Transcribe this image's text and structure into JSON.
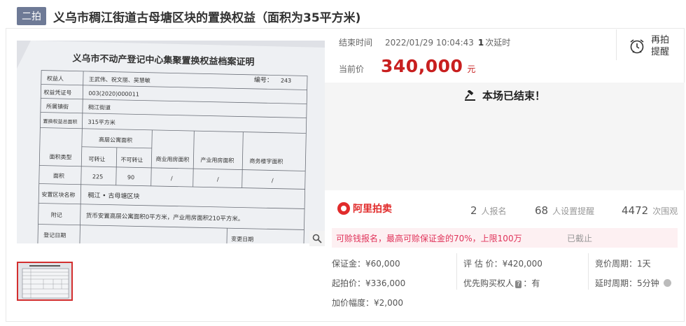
{
  "header": {
    "tag": "二拍",
    "title": "义乌市稠江街道古母塘区块的置换权益（面积为35平方米)"
  },
  "photo": {
    "doc_title": "义乌市不动产登记中心集聚置换权益档案证明",
    "doc_no_label": "编号：",
    "doc_no": "243",
    "rows": [
      {
        "k": "权益人",
        "v": "王武伟、祝文丽、吴慧敏"
      },
      {
        "k": "权益凭证号",
        "v": "003(2020)000011"
      },
      {
        "k": "所属镇街",
        "v": "稠江街道"
      },
      {
        "k": "置换权益总面积",
        "v": "315平方米"
      }
    ],
    "area_type_label": "面积类型",
    "highrise_label": "高层公寓面积",
    "transferable_label": "可转让",
    "nontransferable_label": "不可转让",
    "commercial_label": "商业用房面积",
    "industrial_label": "产业用房面积",
    "office_label": "商务楼宇面积",
    "area_label": "面积",
    "area_transferable": "225",
    "area_nontransferable": "90",
    "dash": "/",
    "block_label": "安置区块名称",
    "block_value": "稠江 • 古母塘区块",
    "note_label": "附记",
    "note_value": "货币安置高层公寓面积0平方米，产业用房面积210平方米。",
    "reg_date_label": "登记日期",
    "change_date_label": "变更日期"
  },
  "auction": {
    "end_time_label": "结束时间",
    "end_time": "2022/01/29 10:04:43",
    "delay_count": "1",
    "delay_suffix": "次延时",
    "current_price_label": "当前价",
    "current_price": "340,000",
    "currency_unit": "元",
    "remind_line1": "再拍",
    "remind_line2": "提醒",
    "ended_text": "本场已结束！"
  },
  "stats": {
    "logo_text": "阿里拍卖",
    "signup_count": "2",
    "signup_label": "人报名",
    "reminder_count": "68",
    "reminder_label": "人设置提醒",
    "views_count": "4472",
    "views_label": "次围观"
  },
  "deposit": {
    "message": "可赊钱报名，最高可赊保证金的70%，上限100万",
    "status": "已截止"
  },
  "details": {
    "deposit": "保证金：¥60,000",
    "appraisal": "评 估 价：¥420,000",
    "bid_cycle": "竞价周期：1天",
    "start_price": "起拍价：¥336,000",
    "priority_buyer_label": "优先购买权人",
    "priority_badge": "?",
    "priority_value": "：有",
    "delay_cycle": "延时周期：5分钟",
    "increment": "加价幅度：¥2,000"
  },
  "colors": {
    "accent_red": "#c81f1f",
    "tag_bg": "#6e7a96",
    "deposit_bg": "#fdf0f2"
  }
}
